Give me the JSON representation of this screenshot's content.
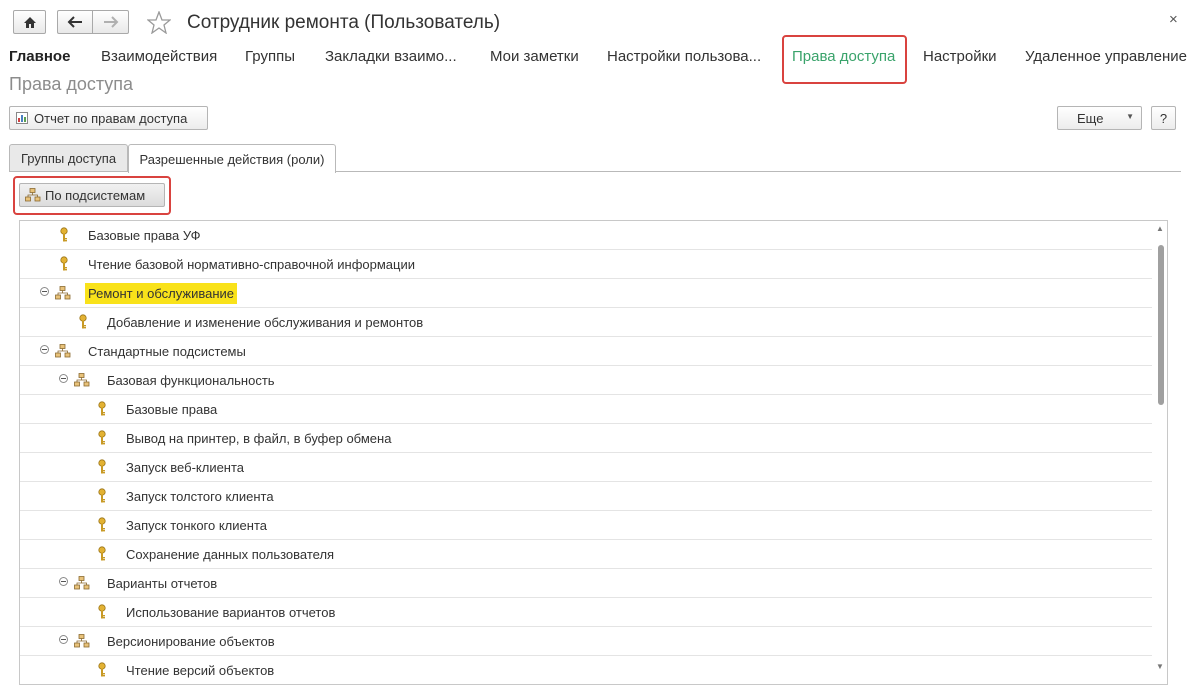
{
  "window": {
    "title": "Сотрудник ремонта (Пользователь)",
    "close": "×"
  },
  "section_tabs": [
    {
      "label": "Главное"
    },
    {
      "label": "Взаимодействия"
    },
    {
      "label": "Группы"
    },
    {
      "label": "Закладки взаимо..."
    },
    {
      "label": "Мои заметки"
    },
    {
      "label": "Настройки пользова..."
    },
    {
      "label": "Права доступа"
    },
    {
      "label": "Настройки"
    },
    {
      "label": "Удаленное управление"
    }
  ],
  "page": {
    "subtitle": "Права доступа"
  },
  "toolbar": {
    "report_label": "Отчет по правам доступа",
    "more_label": "Еще",
    "help_label": "?"
  },
  "tabs": [
    {
      "label": "Группы доступа"
    },
    {
      "label": "Разрешенные действия (роли)"
    }
  ],
  "subsystems_button": {
    "label": "По подсистемам"
  },
  "tree": [
    {
      "label": "Базовые права УФ",
      "type": "role",
      "level": 0
    },
    {
      "label": "Чтение базовой нормативно-справочной информации",
      "type": "role",
      "level": 0
    },
    {
      "label": "Ремонт и обслуживание",
      "type": "group",
      "level": 0,
      "highlighted": true
    },
    {
      "label": "Добавление и изменение обслуживания и ремонтов",
      "type": "role",
      "level": 1
    },
    {
      "label": "Стандартные подсистемы",
      "type": "group",
      "level": 0
    },
    {
      "label": "Базовая функциональность",
      "type": "group",
      "level": 1
    },
    {
      "label": "Базовые права",
      "type": "role",
      "level": 2
    },
    {
      "label": "Вывод на принтер, в файл, в буфер обмена",
      "type": "role",
      "level": 2
    },
    {
      "label": "Запуск веб-клиента",
      "type": "role",
      "level": 2
    },
    {
      "label": "Запуск толстого клиента",
      "type": "role",
      "level": 2
    },
    {
      "label": "Запуск тонкого клиента",
      "type": "role",
      "level": 2
    },
    {
      "label": "Сохранение данных пользователя",
      "type": "role",
      "level": 2
    },
    {
      "label": "Варианты отчетов",
      "type": "group",
      "level": 1
    },
    {
      "label": "Использование вариантов отчетов",
      "type": "role",
      "level": 2
    },
    {
      "label": "Версионирование объектов",
      "type": "group",
      "level": 1
    },
    {
      "label": "Чтение версий объектов",
      "type": "role",
      "level": 2
    }
  ],
  "colors": {
    "active_tab": "#3aa36b",
    "highlight": "#f9e21a",
    "annotation_box": "#d9433f"
  },
  "icons": [
    "home-icon",
    "back-arrow-icon",
    "forward-arrow-icon",
    "star-icon",
    "close-icon",
    "report-icon",
    "dropdown-arrow-icon",
    "key-icon",
    "subsystem-icon",
    "collapse-icon",
    "scroll-up-icon",
    "scroll-down-icon"
  ]
}
